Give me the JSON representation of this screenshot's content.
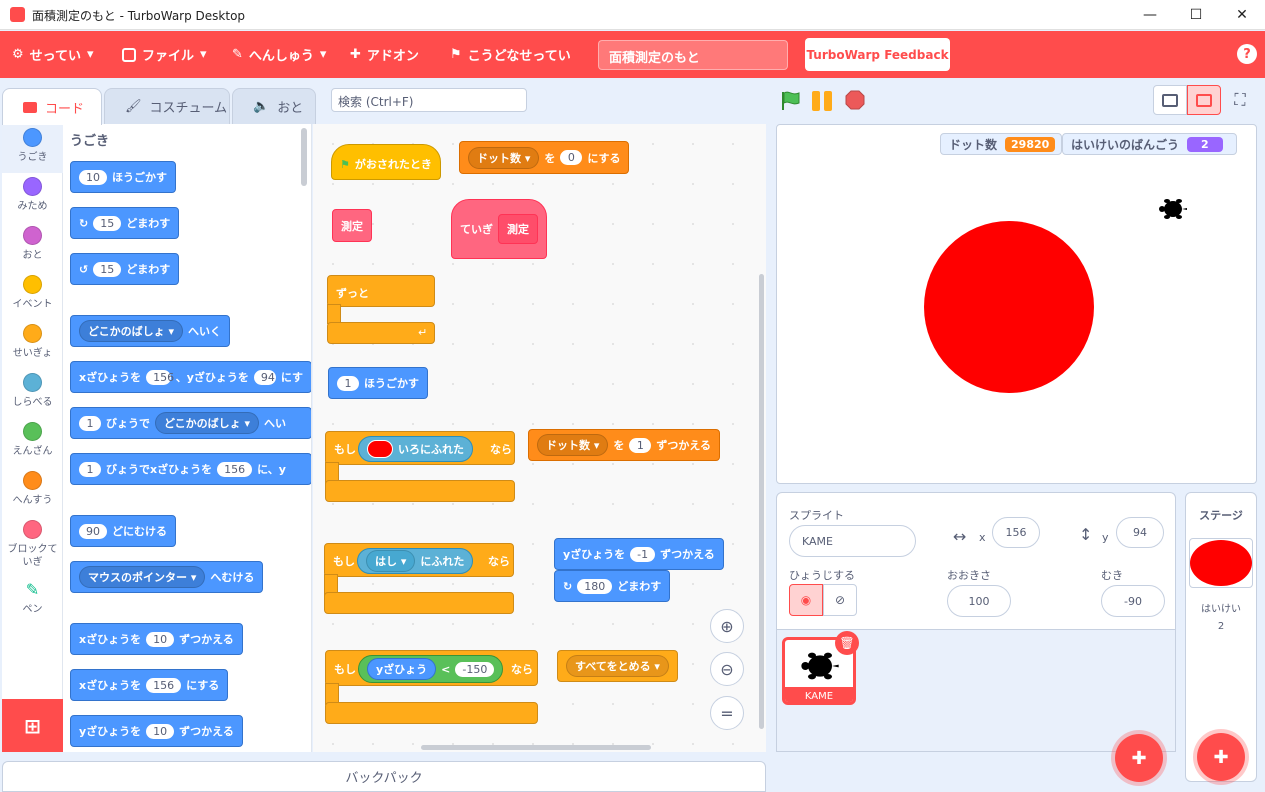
{
  "window": {
    "title": "面積測定のもと - TurboWarp Desktop"
  },
  "menu": {
    "settings": "せってい",
    "file": "ファイル",
    "edit": "へんしゅう",
    "addons": "アドオン",
    "advanced": "こうどなせってい",
    "project_title": "面積測定のもと",
    "feedback": "TurboWarp Feedback",
    "help": "?"
  },
  "tabs": {
    "code": "コード",
    "costumes": "コスチューム",
    "sounds": "おと"
  },
  "search": {
    "placeholder": "検索 (Ctrl+F)"
  },
  "categories": [
    {
      "label": "うごき",
      "color": "#4c97ff"
    },
    {
      "label": "みため",
      "color": "#9966ff"
    },
    {
      "label": "おと",
      "color": "#cf63cf"
    },
    {
      "label": "イベント",
      "color": "#ffbf00"
    },
    {
      "label": "せいぎょ",
      "color": "#ffab19"
    },
    {
      "label": "しらべる",
      "color": "#5cb1d6"
    },
    {
      "label": "えんざん",
      "color": "#59c059"
    },
    {
      "label": "へんすう",
      "color": "#ff8c1a"
    },
    {
      "label": "ブロックて\nいぎ",
      "color": "#ff6680"
    },
    {
      "label": "ペン",
      "color": "#0fbd8c"
    }
  ],
  "palette": {
    "heading": "うごき",
    "move_steps": {
      "value": "10",
      "text": "ほうごかす"
    },
    "turn_right": {
      "value": "15",
      "text": "どまわす"
    },
    "turn_left": {
      "value": "15",
      "text": "どまわす"
    },
    "goto": {
      "menu": "どこかのばしょ",
      "text": "へいく"
    },
    "goto_xy": {
      "x_label": "xざひょうを",
      "x": "156",
      "mid": "、yざひょうを",
      "y": "94",
      "end": "にす"
    },
    "glide": {
      "secs": "1",
      "text1": "びょうで",
      "menu": "どこかのばしょ",
      "text2": "へい"
    },
    "glide_xy": {
      "secs": "1",
      "text1": "びょうでxざひょうを",
      "x": "156",
      "text2": "に、y"
    },
    "point_dir": {
      "value": "90",
      "text": "どにむける"
    },
    "point_towards": {
      "menu": "マウスのポインター",
      "text": "へむける"
    },
    "change_x": {
      "label": "xざひょうを",
      "value": "10",
      "text": "ずつかえる"
    },
    "set_x": {
      "label": "xざひょうを",
      "value": "156",
      "text": "にする"
    },
    "change_y": {
      "label": "yざひょうを",
      "value": "10",
      "text": "ずつかえる"
    }
  },
  "workspace": {
    "hat": "がおされたとき",
    "set_var": {
      "var": "ドット数",
      "to": "を",
      "value": "0",
      "text": "にする"
    },
    "measure_call": "測定",
    "define": {
      "label": "ていぎ",
      "name": "測定"
    },
    "forever": "ずっと",
    "move": {
      "value": "1",
      "text": "ほうごかす"
    },
    "if1": {
      "if": "もし",
      "touching_color": "いろにふれた",
      "then": "なら"
    },
    "change_var": {
      "var": "ドット数",
      "by": "を",
      "value": "1",
      "text": "ずつかえる"
    },
    "if2": {
      "if": "もし",
      "menu": "はし",
      "touching": "にふれた",
      "then": "なら"
    },
    "change_y": {
      "label": "yざひょうを",
      "value": "-1",
      "text": "ずつかえる"
    },
    "turn": {
      "value": "180",
      "text": "どまわす"
    },
    "if3": {
      "if": "もし",
      "reporter": "yざひょう",
      "op": "<",
      "value": "-150",
      "then": "なら"
    },
    "stop": {
      "menu": "すべてをとめる"
    }
  },
  "monitors": [
    {
      "label": "ドット数",
      "value": "29820",
      "color": "#ff8c1a"
    },
    {
      "label": "はいけいのばんごう",
      "value": "2",
      "color": "#9966ff"
    }
  ],
  "sprite_info": {
    "sprite_label": "スプライト",
    "sprite_name": "KAME",
    "x_label": "x",
    "x": "156",
    "y_label": "y",
    "y": "94",
    "show_label": "ひょうじする",
    "size_label": "おおきさ",
    "size": "100",
    "direction_label": "むき",
    "direction": "-90"
  },
  "sprites": [
    {
      "name": "KAME"
    }
  ],
  "stage_panel": {
    "title": "ステージ",
    "backdrops_label": "はいけい",
    "backdrops": "2"
  },
  "backpack": "バックパック",
  "colors": {
    "accent": "#ff4c4c"
  }
}
